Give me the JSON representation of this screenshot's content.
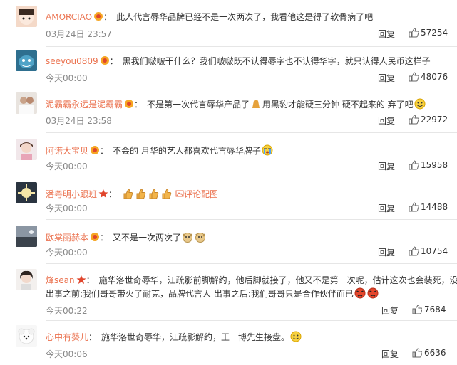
{
  "colors": {
    "username": "#eb7350",
    "meta": "#888888",
    "divider": "#e6e6e6"
  },
  "comments": [
    {
      "username": "AMORCIAO",
      "text": "此人代言辱华品牌已经不是一次两次了，我看他这是得了软骨病了吧",
      "time": "03月24日 23:57",
      "reply": "回复",
      "likes": "57254"
    },
    {
      "username": "seeyou0809",
      "text": "黑我们啵啵干什么？我们啵啵既不认得辱字也不认得华字，就只认得人民币这样子",
      "time": "今天00:00",
      "reply": "回复",
      "likes": "48076"
    },
    {
      "username": "泥霸霸永远是泥霸霸",
      "text": "不是第一次代言辱华产品了",
      "text_after": "用黑豹才能硬三分钟 硬不起来的 弃了吧",
      "time": "03月24日 23:58",
      "reply": "回复",
      "likes": "22972"
    },
    {
      "username": "阿诺大宝贝",
      "text": "不会的 月华的艺人都喜欢代言辱华牌子",
      "time": "今天00:00",
      "reply": "回复",
      "likes": "15958"
    },
    {
      "username": "潘粤明小跟班",
      "text": "",
      "link": "评论配图",
      "time": "今天00:00",
      "reply": "回复",
      "likes": "14488"
    },
    {
      "username": "欧棠丽赫本",
      "text": "又不是一次两次了",
      "time": "今天00:00",
      "reply": "回复",
      "likes": "10754"
    },
    {
      "username": "烽sean",
      "text": "施华洛世奇辱华，江疏影前脚解约，他后脚就接了，他又不是第一次呢，估计这次也会装死，没",
      "text_line2": "出事之前:我们哥哥带火了耐克，品牌代言人 出事之后:我们哥哥只是合作伙伴而已",
      "time": "今天00:22",
      "reply": "回复",
      "likes": "7684"
    },
    {
      "username": "心中有葵儿",
      "text": "施华洛世奇辱华，江疏影解约，王一博先生接盘。",
      "time": "今天00:06",
      "reply": "回复",
      "likes": "6636"
    }
  ]
}
